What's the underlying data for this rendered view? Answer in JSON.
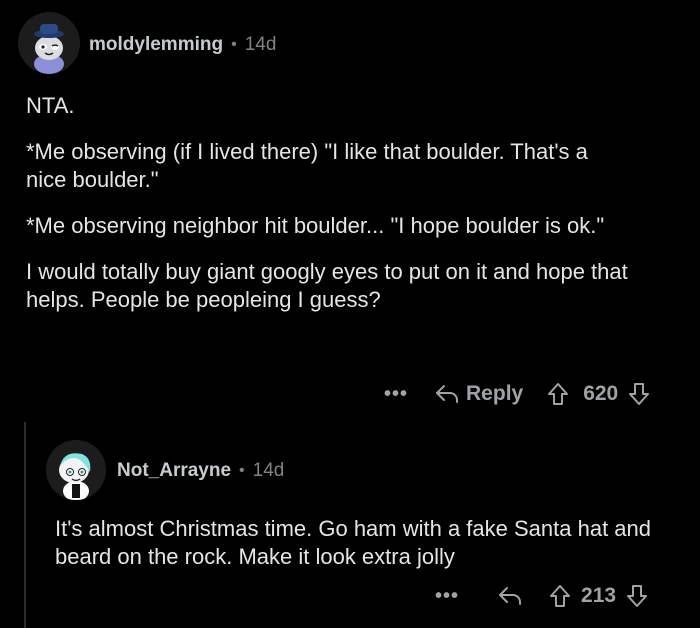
{
  "comment": {
    "username": "moldylemming",
    "separator": "•",
    "age": "14d",
    "paragraphs": [
      "NTA.",
      "*Me observing (if I lived there) \"I like that boulder. That's a nice boulder.\"",
      "*Me observing neighbor hit boulder... \"I hope boulder is ok.\"",
      "I would totally buy giant googly eyes to put on it and hope that helps. People be peopleing I guess?"
    ],
    "more_label": "•••",
    "reply_label": "Reply",
    "vote_count": "620"
  },
  "reply": {
    "username": "Not_Arrayne",
    "separator": "•",
    "age": "14d",
    "text": "It's almost Christmas time. Go ham with a fake Santa hat and beard on the rock. Make it look extra jolly",
    "more_label": "•••",
    "vote_count": "213"
  },
  "colors": {
    "background": "#000000",
    "text": "#e3e5e7",
    "muted": "#818384",
    "action": "#a0a3a5",
    "thread_line": "#2b2c2e"
  },
  "icons": {
    "reply": "reply-arrow-icon",
    "upvote": "upvote-arrow-icon",
    "downvote": "downvote-arrow-icon",
    "more": "ellipsis-icon"
  }
}
